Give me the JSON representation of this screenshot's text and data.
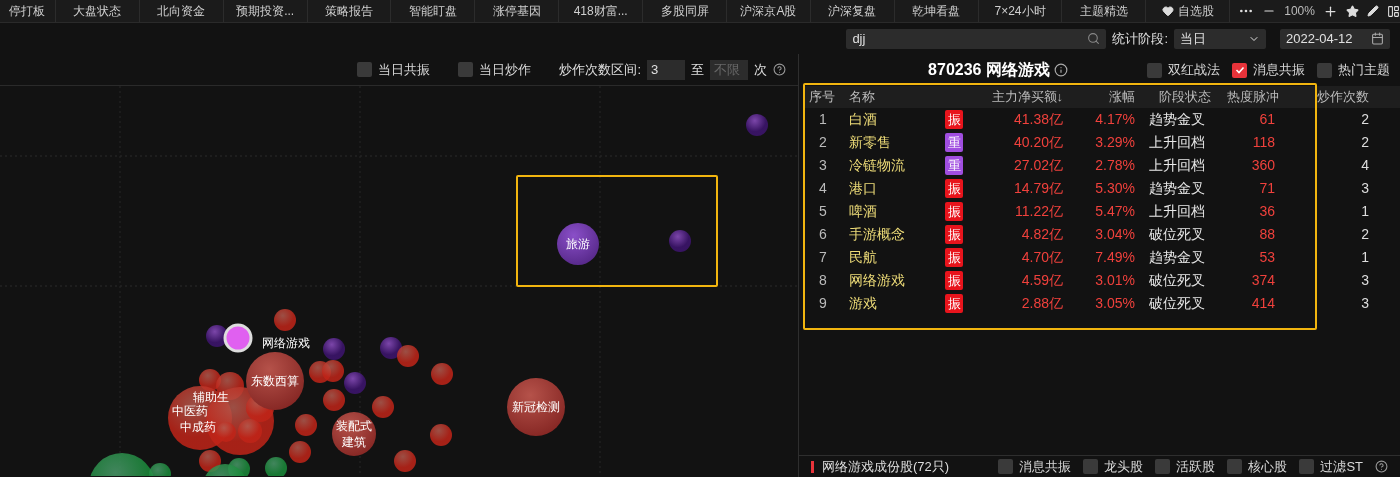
{
  "nav_tabs": [
    {
      "label": "停打板",
      "kind": "text"
    },
    {
      "label": "大盘状态",
      "kind": "text"
    },
    {
      "label": "北向资金",
      "kind": "text"
    },
    {
      "label": "预期投资...",
      "kind": "text"
    },
    {
      "label": "策略报告",
      "kind": "text"
    },
    {
      "label": "智能盯盘",
      "kind": "text"
    },
    {
      "label": "涨停基因",
      "kind": "text"
    },
    {
      "label": "418财富...",
      "kind": "text"
    },
    {
      "label": "多股同屏",
      "kind": "text"
    },
    {
      "label": "沪深京A股",
      "kind": "text"
    },
    {
      "label": "沪深复盘",
      "kind": "text"
    },
    {
      "label": "乾坤看盘",
      "kind": "text"
    },
    {
      "label": "7×24小时",
      "kind": "text"
    },
    {
      "label": "主题精选",
      "kind": "text"
    },
    {
      "label": "自选股",
      "kind": "favorite"
    }
  ],
  "zoom": "100%",
  "filter_bar": {
    "search": {
      "value": "djj"
    },
    "period_label": "统计阶段:",
    "period": "当日",
    "date": "2022-04-12"
  },
  "chart_toolbar": {
    "checkboxes": [
      {
        "label": "当日共振",
        "checked": false
      },
      {
        "label": "当日炒作",
        "checked": false
      }
    ],
    "range_label": "炒作次数区间:",
    "range_min": {
      "value": "3"
    },
    "range_to": "至",
    "range_max": {
      "placeholder": "不限"
    },
    "unit": "次"
  },
  "bubbles": [
    {
      "label": "旅游",
      "kind": "purple"
    },
    {
      "label": "新冠检测",
      "kind": "red"
    },
    {
      "label": "装配式建筑",
      "kind": "red"
    },
    {
      "label": "东数西算",
      "kind": "red"
    }
  ],
  "bubble_labels": [
    "网络游戏",
    "辅助生",
    "中医药",
    "中成药"
  ],
  "detail": {
    "title": "870236 网络游戏",
    "options": [
      {
        "label": "双红战法",
        "checked": false
      },
      {
        "label": "消息共振",
        "checked": true
      },
      {
        "label": "热门主题",
        "checked": false
      }
    ],
    "columns": [
      "序号",
      "名称",
      "",
      "主力净买额↓",
      "涨幅",
      "阶段状态",
      "热度脉冲",
      "炒作次数"
    ],
    "rows": [
      {
        "index": "1",
        "name": "白酒",
        "tag": "振",
        "kind": "resonance",
        "net_buy": "41.38亿",
        "change": "4.17%",
        "phase": "趋势金叉",
        "heat": "61",
        "count": "2"
      },
      {
        "index": "2",
        "name": "新零售",
        "tag": "重",
        "kind": "key",
        "net_buy": "40.20亿",
        "change": "3.29%",
        "phase": "上升回档",
        "heat": "118",
        "count": "2"
      },
      {
        "index": "3",
        "name": "冷链物流",
        "tag": "重",
        "kind": "key",
        "net_buy": "27.02亿",
        "change": "2.78%",
        "phase": "上升回档",
        "heat": "360",
        "count": "4"
      },
      {
        "index": "4",
        "name": "港口",
        "tag": "振",
        "kind": "resonance",
        "net_buy": "14.79亿",
        "change": "5.30%",
        "phase": "趋势金叉",
        "heat": "71",
        "count": "3"
      },
      {
        "index": "5",
        "name": "啤酒",
        "tag": "振",
        "kind": "resonance",
        "net_buy": "11.22亿",
        "change": "5.47%",
        "phase": "上升回档",
        "heat": "36",
        "count": "1"
      },
      {
        "index": "6",
        "name": "手游概念",
        "tag": "振",
        "kind": "resonance",
        "net_buy": "4.82亿",
        "change": "3.04%",
        "phase": "破位死叉",
        "heat": "88",
        "count": "2"
      },
      {
        "index": "7",
        "name": "民航",
        "tag": "振",
        "kind": "resonance",
        "net_buy": "4.70亿",
        "change": "7.49%",
        "phase": "趋势金叉",
        "heat": "53",
        "count": "1"
      },
      {
        "index": "8",
        "name": "网络游戏",
        "tag": "振",
        "kind": "resonance",
        "net_buy": "4.59亿",
        "change": "3.01%",
        "phase": "破位死叉",
        "heat": "374",
        "count": "3"
      },
      {
        "index": "9",
        "name": "游戏",
        "tag": "振",
        "kind": "resonance",
        "net_buy": "2.88亿",
        "change": "3.05%",
        "phase": "破位死叉",
        "heat": "414",
        "count": "3"
      }
    ]
  },
  "constituents": {
    "title": "网络游戏成份股(72只)",
    "options": [
      {
        "label": "消息共振",
        "checked": false
      },
      {
        "label": "龙头股",
        "checked": false
      },
      {
        "label": "活跃股",
        "checked": false
      },
      {
        "label": "核心股",
        "checked": false
      },
      {
        "label": "过滤ST",
        "checked": false
      }
    ]
  }
}
